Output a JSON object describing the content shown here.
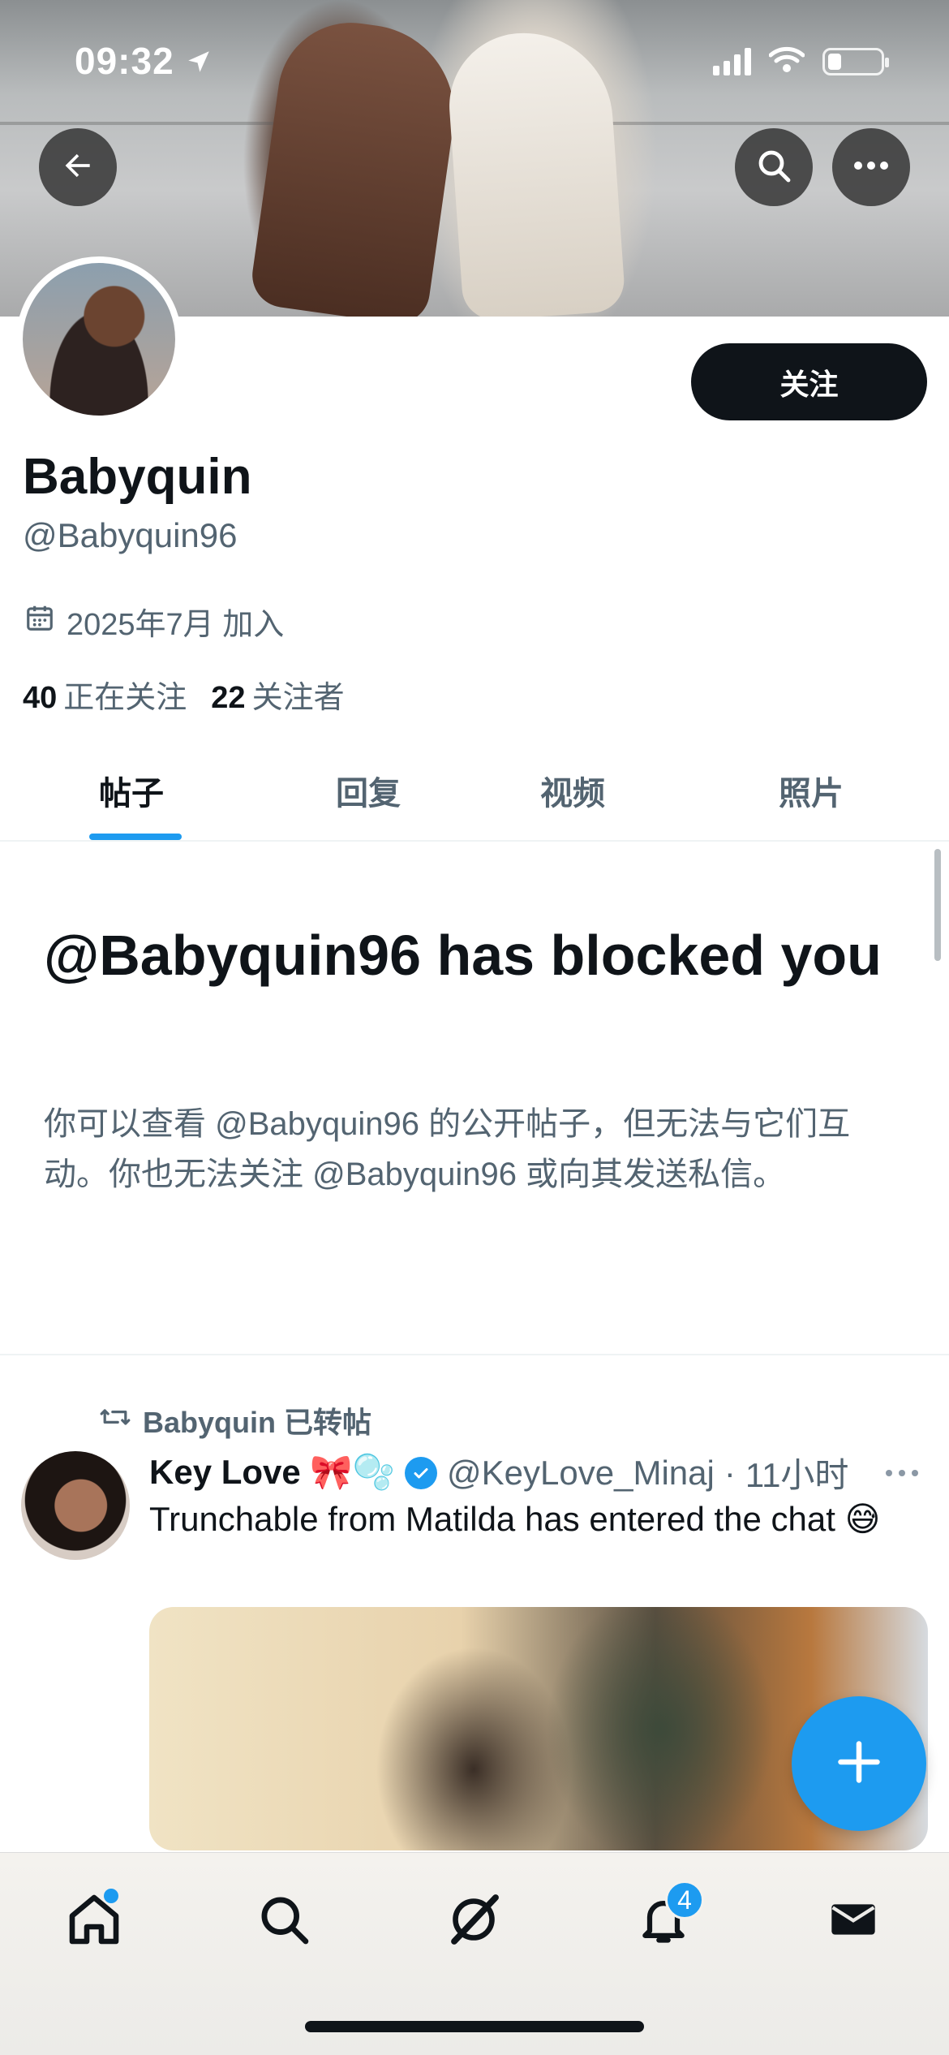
{
  "status_bar": {
    "time": "09:32"
  },
  "profile": {
    "follow_label": "关注",
    "display_name": "Babyquin",
    "handle": "@Babyquin96",
    "joined": "2025年7月 加入",
    "following_count": "40",
    "following_label": "正在关注",
    "followers_count": "22",
    "followers_label": "关注者"
  },
  "tabs": [
    {
      "label": "帖子",
      "active": true
    },
    {
      "label": "回复",
      "active": false
    },
    {
      "label": "视频",
      "active": false
    },
    {
      "label": "照片",
      "active": false
    }
  ],
  "blocked": {
    "title": "@Babyquin96 has blocked you",
    "description": "你可以查看 @Babyquin96 的公开帖子，但无法与它们互动。你也无法关注 @Babyquin96 或向其发送私信。"
  },
  "tweet": {
    "retweet_label": "Babyquin 已转帖",
    "author_name": "Key Love 🎀🫧",
    "author_handle": "@KeyLove_Minaj",
    "separator": "·",
    "time": "11小时",
    "text": "Trunchable from Matilda has entered the chat 😅"
  },
  "bottom_nav": {
    "notifications_badge": "4"
  },
  "colors": {
    "accent": "#1d9bf0",
    "text_primary": "#0f1419",
    "text_secondary": "#536471",
    "follow_button": "#0f1419"
  },
  "icons": [
    "arrow-left-icon",
    "search-icon",
    "more-icon",
    "calendar-icon",
    "retweet-icon",
    "verified-icon",
    "plus-icon",
    "home-icon",
    "explore-icon",
    "grok-icon",
    "bell-icon",
    "mail-icon"
  ]
}
